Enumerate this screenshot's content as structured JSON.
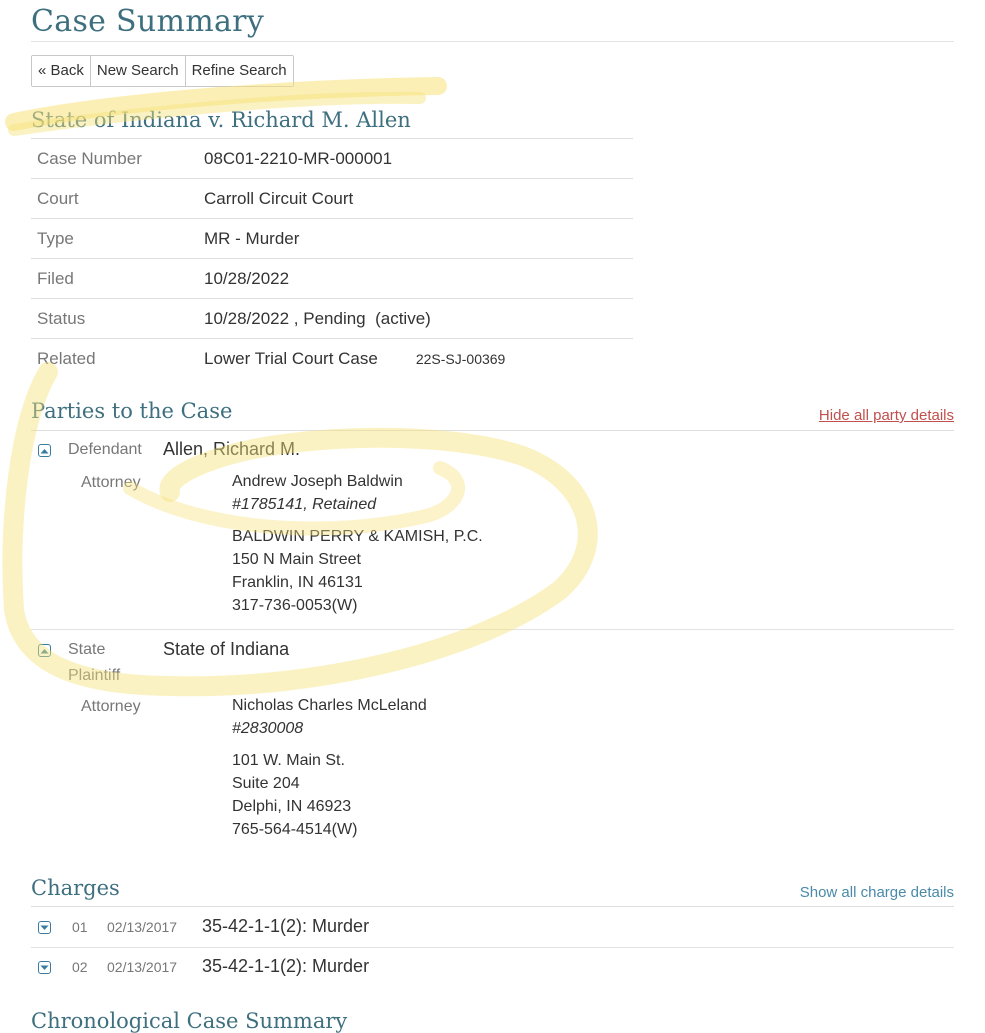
{
  "header": {
    "title": "Case Summary"
  },
  "toolbar": {
    "back": "« Back",
    "new_search": "New Search",
    "refine_search": "Refine Search"
  },
  "case": {
    "title": "State of Indiana v. Richard M. Allen",
    "fields": [
      {
        "label": "Case Number",
        "value": "08C01-2210-MR-000001"
      },
      {
        "label": "Court",
        "value": "Carroll Circuit Court"
      },
      {
        "label": "Type",
        "value": "MR - Murder"
      },
      {
        "label": "Filed",
        "value": "10/28/2022"
      },
      {
        "label": "Status",
        "value": "10/28/2022 , Pending  (active)"
      },
      {
        "label": "Related",
        "value": "Lower Trial Court Case",
        "extra": "22S-SJ-00369"
      }
    ]
  },
  "parties": {
    "title": "Parties to the Case",
    "hide_link": "Hide all party details",
    "attorney_label": "Attorney",
    "defendant": {
      "role": "Defendant",
      "name": "Allen, Richard M.",
      "attorney_name": "Andrew Joseph Baldwin",
      "attorney_id": "#1785141, Retained",
      "address": [
        "BALDWIN PERRY & KAMISH, P.C.",
        "150 N Main Street",
        "Franklin, IN 46131",
        "317-736-0053(W)"
      ]
    },
    "plaintiff": {
      "role_line1": "State",
      "role_line2": "Plaintiff",
      "name": "State of Indiana",
      "attorney_name": "Nicholas Charles McLeland",
      "attorney_id": "#2830008",
      "address": [
        "101 W. Main St.",
        "Suite 204",
        "Delphi, IN 46923",
        "765-564-4514(W)"
      ]
    }
  },
  "charges": {
    "title": "Charges",
    "show_link": "Show all charge details",
    "items": [
      {
        "num": "01",
        "date": "02/13/2017",
        "desc": "35-42-1-1(2): Murder"
      },
      {
        "num": "02",
        "date": "02/13/2017",
        "desc": "35-42-1-1(2): Murder"
      }
    ]
  },
  "chrono": {
    "title": "Chronological Case Summary"
  },
  "colors": {
    "heading": "#3d6f7f",
    "link_red": "#c0504d",
    "link_teal": "#4a8aa8",
    "highlight": "#f7e27a"
  },
  "icons": {
    "expanded": "chevron-up-icon",
    "collapsed": "chevron-down-icon"
  }
}
